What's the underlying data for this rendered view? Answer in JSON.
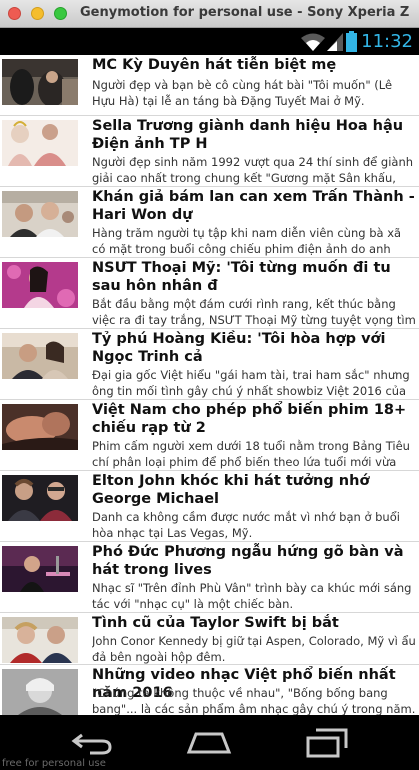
{
  "window": {
    "title": "Genymotion for personal use - Sony Xperia Z"
  },
  "status_bar": {
    "time": "11:32",
    "icons": [
      "wifi-icon",
      "signal-icon",
      "battery-icon"
    ]
  },
  "articles": [
    {
      "title": "MC Kỳ Duyên hát tiễn biệt mẹ",
      "description": "Người đẹp và bạn bè cô cùng hát bài \"Tôi muốn\" (Lê Hựu Hà) tại lễ an táng bà Đặng Tuyết Mai ở Mỹ."
    },
    {
      "title": "Sella Trương giành danh hiệu Hoa hậu Điện ảnh TP H",
      "description": "Người đẹp sinh năm 1992 vượt qua 24 thí sinh để giành giải cao nhất trong chung kết \"Gương mặt Sân khấu, Điện"
    },
    {
      "title": "Khán giả bám lan can xem Trấn Thành - Hari Won dự",
      "description": "Hàng trăm người tụ tập khi nam diễn viên cùng bà xã có mặt trong buổi công chiếu phim điện ảnh do anh đóng, tối"
    },
    {
      "title": "NSƯT Thoại Mỹ: 'Tôi từng muốn đi tu sau hôn nhân đ",
      "description": "Bắt đầu bằng một đám cưới rình rang, kết thúc bằng việc ra đi tay trắng, NSƯT Thoại Mỹ từng tuyệt vọng tìm đến"
    },
    {
      "title": "Tỷ phú Hoàng Kiều: 'Tôi hòa hợp với Ngọc Trinh cả",
      "description": "Đại gia gốc Việt hiểu \"gái ham tài, trai ham sắc\" nhưng ông tin mối tình gây chú ý nhất showbiz Việt 2016 của ông"
    },
    {
      "title": "Việt Nam cho phép phổ biến phim 18+ chiếu rạp từ 2",
      "description": "Phim cấm người xem dưới 18 tuổi nằm trong Bảng Tiêu chí phân loại phim để phổ biến theo lứa tuổi mới vừa được"
    },
    {
      "title": "Elton John khóc khi hát tưởng nhớ George Michael",
      "description": "Danh ca không cầm được nước mắt vì nhớ bạn ở buổi hòa nhạc tại Las Vegas, Mỹ."
    },
    {
      "title": "Phó Đức Phương ngẫu hứng gõ bàn và hát trong lives",
      "description": "Nhạc sĩ \"Trên đỉnh Phù Vân\" trình bày ca khúc mới sáng tác với \"nhạc cụ\" là một chiếc bàn."
    },
    {
      "title": "Tình cũ của Taylor Swift bị bắt",
      "description": "John Conor Kennedy bị giữ tại Aspen, Colorado, Mỹ vì ẩu đả bên ngoài hộp đêm."
    },
    {
      "title": "Những video nhạc Việt phổ biến nhất năm 2016",
      "description": "\"Chúng ta không thuộc về nhau\", \"Bống bống bang bang\"... là các sản phẩm âm nhạc gây chú ý trong năm."
    }
  ],
  "nav": {
    "icons": [
      "back-icon",
      "home-icon",
      "recent-apps-icon"
    ]
  },
  "watermark": "free for personal use"
}
